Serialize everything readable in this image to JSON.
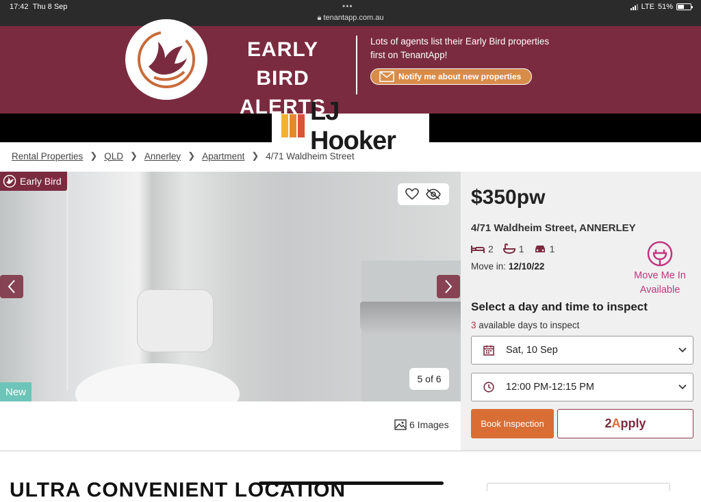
{
  "status_bar": {
    "time": "17:42",
    "date": "Thu 8 Sep",
    "url": "tenantapp.com.au",
    "network": "LTE",
    "battery": "51%",
    "battery_level": 0.51
  },
  "banner": {
    "headline_line1": "EARLY BIRD",
    "headline_line2": "ALERTS",
    "description_line1": "Lots of agents list their Early Bird properties",
    "description_line2": "first on TenantApp!",
    "notify_label": "Notify me about new properties",
    "background_color": "#7b2b3f",
    "accent_color": "#d88c4a"
  },
  "agency": {
    "name": "LJ Hooker",
    "stripe_colors": [
      "#f2b230",
      "#e8872e",
      "#d9533a"
    ]
  },
  "breadcrumb": {
    "items": [
      "Rental Properties",
      "QLD",
      "Annerley",
      "Apartment"
    ],
    "current": "4/71 Waldheim Street"
  },
  "gallery": {
    "early_bird_badge": "Early Bird",
    "new_badge": "New",
    "counter": "5 of 6",
    "images_link": "6 Images"
  },
  "listing": {
    "price": "$350pw",
    "address": "4/71 Waldheim Street, ANNERLEY",
    "beds": "2",
    "baths": "1",
    "cars": "1",
    "move_in_label": "Move in:",
    "move_in_date": "12/10/22",
    "move_me_in_line1": "Move Me In",
    "move_me_in_line2": "Available",
    "accent_pink": "#c2357e"
  },
  "inspection": {
    "title": "Select a day and time to inspect",
    "available_count": "3",
    "available_text": "available days to inspect",
    "selected_day": "Sat, 10 Sep",
    "selected_time": "12:00 PM-12:15 PM",
    "book_label": "Book Inspection",
    "apply_label_prefix": "2",
    "apply_label_a": "A",
    "apply_label_suffix": "pply"
  },
  "below_fold": {
    "section_heading": "ULTRA CONVENIENT LOCATION"
  }
}
